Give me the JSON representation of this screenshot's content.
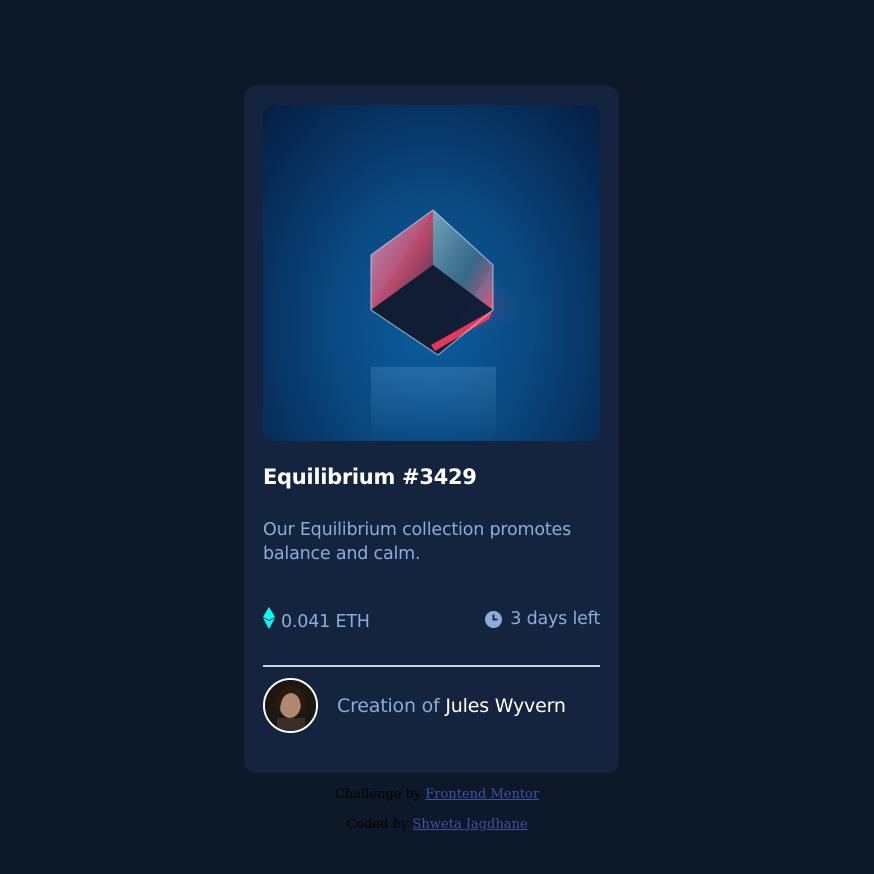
{
  "card": {
    "image_alt": "Equilibrium",
    "title": "Equilibrium #3429",
    "description": "Our Equilibrium collection promotes balance and calm.",
    "price": "0.041 ETH",
    "price_icon": "ethereum-icon",
    "time_left": "3 days left",
    "time_icon": "clock-icon",
    "creator_prefix": "Creation of",
    "creator_name": "Jules Wyvern"
  },
  "attribution": {
    "challenge_prefix": "Challenge by",
    "challenge_link": "Frontend Mentor",
    "coded_prefix": "Coded by",
    "coded_link": "Shweta Jagdhane"
  },
  "colors": {
    "page_bg": "#0d1829",
    "card_bg": "#15243e",
    "accent_cyan": "#00fff8",
    "soft_blue": "#8bacd9",
    "white": "#ffffff"
  }
}
